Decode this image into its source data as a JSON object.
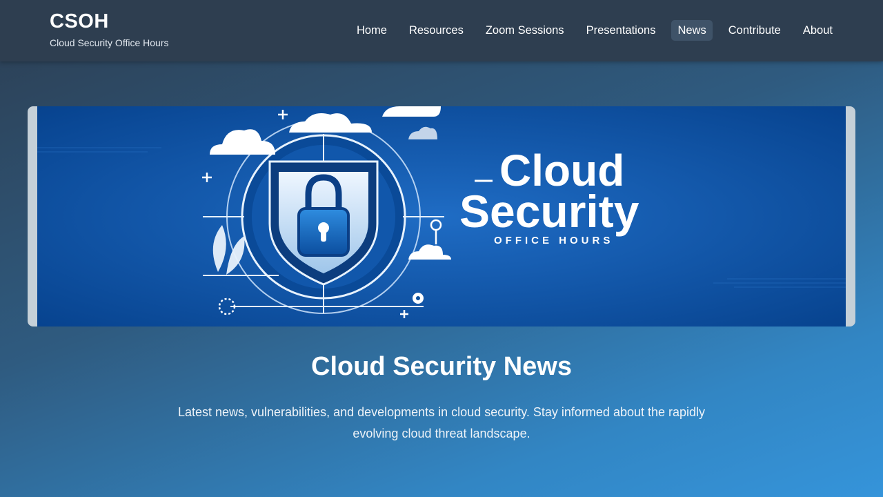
{
  "brand": {
    "title": "CSOH",
    "subtitle": "Cloud Security Office Hours"
  },
  "nav": {
    "items": [
      {
        "label": "Home"
      },
      {
        "label": "Resources"
      },
      {
        "label": "Zoom Sessions"
      },
      {
        "label": "Presentations"
      },
      {
        "label": "News",
        "active": true
      },
      {
        "label": "Contribute"
      },
      {
        "label": "About"
      }
    ]
  },
  "hero": {
    "line1": "Cloud",
    "line2": "Security",
    "line3": "OFFICE HOURS",
    "icons": [
      "cloud-icon",
      "shield-icon",
      "padlock-icon",
      "gear-icon"
    ]
  },
  "page": {
    "heading": "Cloud Security News",
    "description": "Latest news, vulnerabilities, and developments in cloud security. Stay informed about the rapidly evolving cloud threat landscape."
  },
  "colors": {
    "header": "#2e3e50",
    "active_nav": "#3f5368",
    "banner": "#0b4f9e"
  }
}
